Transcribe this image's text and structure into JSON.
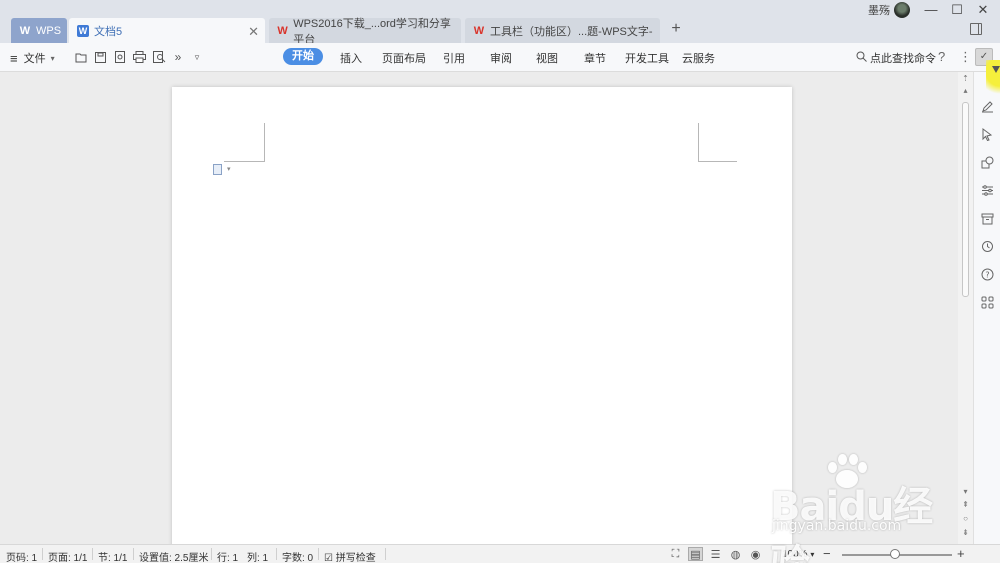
{
  "titlebar": {
    "tabs": [
      {
        "label": "WPS",
        "icon": "w-logo-icon"
      },
      {
        "label": "文档5",
        "icon": "w-doc-icon"
      },
      {
        "label": "WPS2016下载_...ord学习和分享平台",
        "icon": "wps-web-icon"
      },
      {
        "label": "工具栏（功能区）...题-WPS文字-",
        "icon": "wps-web-icon"
      }
    ],
    "new_tab": "+",
    "user_name": "墨殇",
    "window_controls": {
      "minimize": "—",
      "maximize": "☐",
      "close": "✕"
    }
  },
  "toolbar": {
    "file_menu": "文件",
    "quick_icons": [
      "open-icon",
      "save-icon",
      "export-pdf-icon",
      "print-icon",
      "print-preview-icon",
      "more-icon",
      "customize-icon"
    ],
    "ribbon_tabs": [
      "开始",
      "插入",
      "页面布局",
      "引用",
      "审阅",
      "视图",
      "章节",
      "开发工具",
      "云服务"
    ],
    "active_tab": "开始",
    "search_label": "点此查找命令",
    "help": "?",
    "more": "⋮"
  },
  "statusbar": {
    "page_code": "页码: 1",
    "page": "页面: 1/1",
    "section": "节: 1/1",
    "setting": "设置值: 2.5厘米",
    "row": "行: 1",
    "col": "列: 1",
    "word_count": "字数: 0",
    "spell_check": "拼写检查",
    "zoom": "100%"
  },
  "watermark": {
    "logo": "Baidu经验",
    "url": "jingyan.baidu.com"
  },
  "colors": {
    "accent": "#4b8ee4",
    "wps_red": "#d9342b",
    "titlebar_bg": "#dfe3ea"
  }
}
